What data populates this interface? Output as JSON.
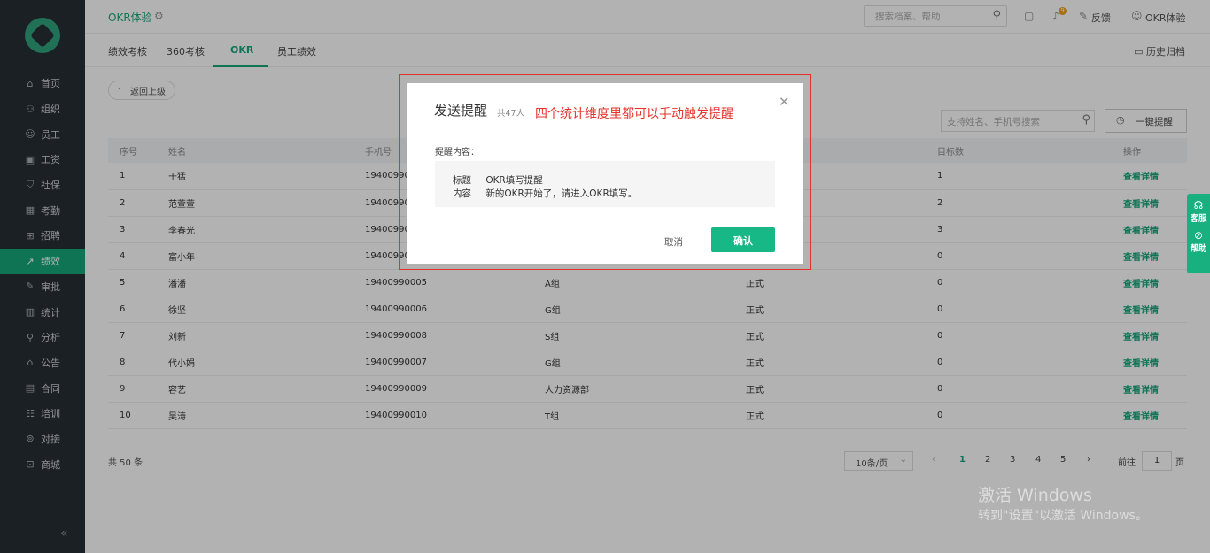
{
  "sidebar": {
    "items": [
      {
        "icon": "home-icon",
        "glyph": "⌂",
        "label": "首页"
      },
      {
        "icon": "org-icon",
        "glyph": "⚇",
        "label": "组织"
      },
      {
        "icon": "employee-icon",
        "glyph": "☺",
        "label": "员工"
      },
      {
        "icon": "salary-icon",
        "glyph": "▣",
        "label": "工资"
      },
      {
        "icon": "insurance-icon",
        "glyph": "⛉",
        "label": "社保"
      },
      {
        "icon": "attendance-icon",
        "glyph": "▦",
        "label": "考勤"
      },
      {
        "icon": "recruit-icon",
        "glyph": "⊞",
        "label": "招聘"
      },
      {
        "icon": "performance-icon",
        "glyph": "↗",
        "label": "绩效",
        "active": true
      },
      {
        "icon": "approval-icon",
        "glyph": "✎",
        "label": "审批"
      },
      {
        "icon": "stats-icon",
        "glyph": "▥",
        "label": "统计"
      },
      {
        "icon": "analysis-icon",
        "glyph": "⚲",
        "label": "分析"
      },
      {
        "icon": "notice-icon",
        "glyph": "⌂",
        "label": "公告"
      },
      {
        "icon": "contract-icon",
        "glyph": "▤",
        "label": "合同"
      },
      {
        "icon": "training-icon",
        "glyph": "☷",
        "label": "培训"
      },
      {
        "icon": "connect-icon",
        "glyph": "⊚",
        "label": "对接"
      },
      {
        "icon": "shop-icon",
        "glyph": "⊡",
        "label": "商城"
      }
    ],
    "collapse_glyph": "«"
  },
  "topbar": {
    "brand": "OKR体验",
    "search_placeholder": "搜索档案、帮助",
    "feedback": "反馈",
    "user": "OKR体验",
    "badge": "9"
  },
  "tabs": [
    "绩效考核",
    "360考核",
    "OKR",
    "员工绩效"
  ],
  "history": "历史归档",
  "back": "返回上级",
  "table_search_placeholder": "支持姓名、手机号搜索",
  "remind_all": "一键提醒",
  "table": {
    "headers": [
      "序号",
      "姓名",
      "手机号",
      "",
      "",
      "目标数",
      "操作"
    ],
    "rows": [
      {
        "idx": "1",
        "name": "于猛",
        "phone": "19400990001",
        "dept": "",
        "type": "",
        "goals": "1",
        "action": "查看详情"
      },
      {
        "idx": "2",
        "name": "范萱萱",
        "phone": "19400990002",
        "dept": "",
        "type": "",
        "goals": "2",
        "action": "查看详情"
      },
      {
        "idx": "3",
        "name": "李春光",
        "phone": "19400990003",
        "dept": "",
        "type": "",
        "goals": "3",
        "action": "查看详情"
      },
      {
        "idx": "4",
        "name": "富小年",
        "phone": "19400990004",
        "dept": "",
        "type": "",
        "goals": "0",
        "action": "查看详情"
      },
      {
        "idx": "5",
        "name": "潘潘",
        "phone": "19400990005",
        "dept": "A组",
        "type": "正式",
        "goals": "0",
        "action": "查看详情"
      },
      {
        "idx": "6",
        "name": "徐坚",
        "phone": "19400990006",
        "dept": "G组",
        "type": "正式",
        "goals": "0",
        "action": "查看详情"
      },
      {
        "idx": "7",
        "name": "刘新",
        "phone": "19400990008",
        "dept": "S组",
        "type": "正式",
        "goals": "0",
        "action": "查看详情"
      },
      {
        "idx": "8",
        "name": "代小娟",
        "phone": "19400990007",
        "dept": "G组",
        "type": "正式",
        "goals": "0",
        "action": "查看详情"
      },
      {
        "idx": "9",
        "name": "容艺",
        "phone": "19400990009",
        "dept": "人力资源部",
        "type": "正式",
        "goals": "0",
        "action": "查看详情"
      },
      {
        "idx": "10",
        "name": "吴涛",
        "phone": "19400990010",
        "dept": "T组",
        "type": "正式",
        "goals": "0",
        "action": "查看详情"
      }
    ]
  },
  "pagination": {
    "total": "共 50 条",
    "page_size": "10条/页",
    "pages": [
      "1",
      "2",
      "3",
      "4",
      "5"
    ],
    "current": "1",
    "goto_label": "前往",
    "goto_value": "1",
    "page_suffix": "页"
  },
  "side_float": [
    {
      "icon": "headset-icon",
      "glyph": "☊",
      "label": "客服"
    },
    {
      "icon": "compass-icon",
      "glyph": "⊘",
      "label": "帮助"
    }
  ],
  "dialog": {
    "title": "发送提醒",
    "count": "共47人",
    "annotation": "四个统计维度里都可以手动触发提醒",
    "content_label": "提醒内容：",
    "title_key": "标题",
    "title_value": "OKR填写提醒",
    "body_key": "内容",
    "body_value": "新的OKR开始了，请进入OKR填写。",
    "cancel": "取消",
    "confirm": "确认"
  },
  "watermark": {
    "line1": "激活 Windows",
    "line2": "转到\"设置\"以激活 Windows。"
  },
  "colors": {
    "accent": "#16a679",
    "sidebar_bg": "#272e36",
    "annotation_red": "#e6322b"
  }
}
